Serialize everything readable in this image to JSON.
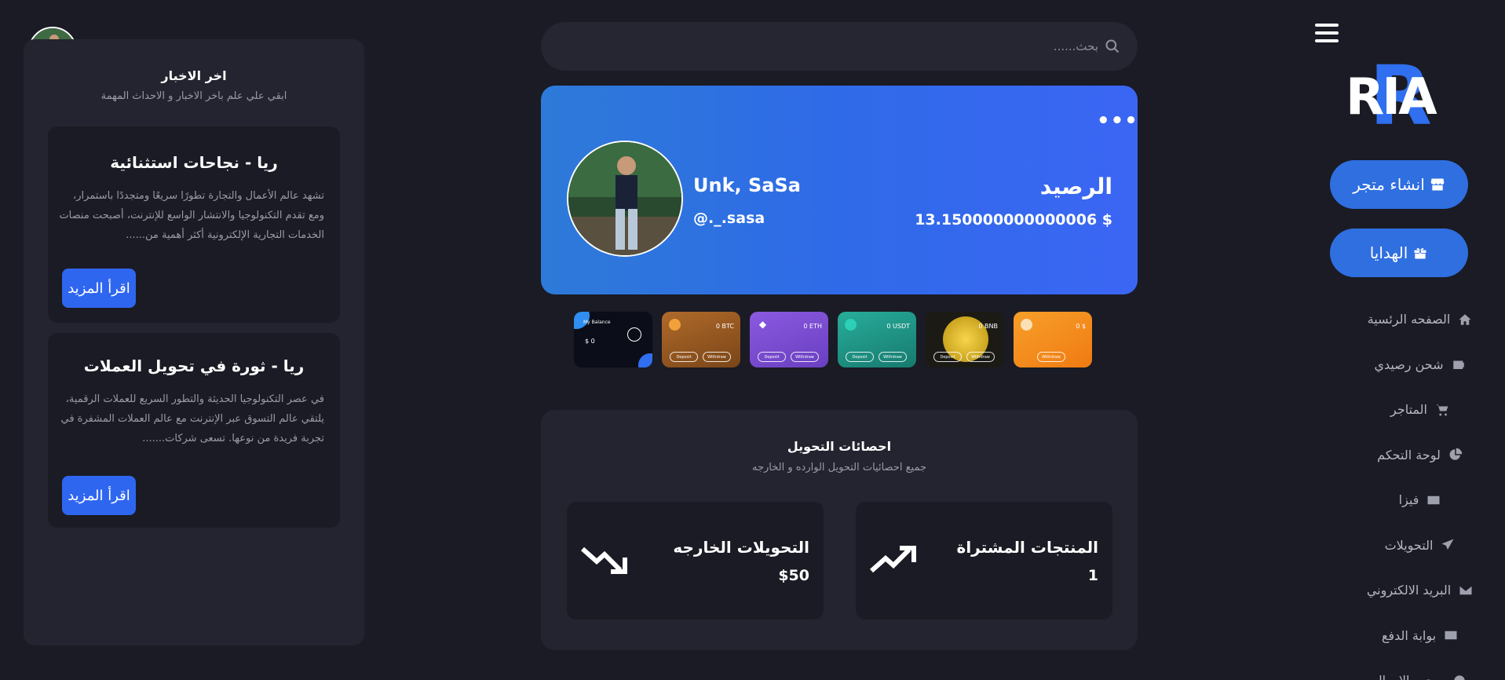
{
  "sidebar": {
    "logo_text": "RIA",
    "create_store_label": "انشاء متجر",
    "gifts_label": "الهدايا",
    "items": [
      {
        "label": "الصفحه الرئسية",
        "icon": "home-icon"
      },
      {
        "label": "شحن رصيدي",
        "icon": "wallet-icon"
      },
      {
        "label": "المتاجر",
        "icon": "cart-icon"
      },
      {
        "label": "لوحة التحكم",
        "icon": "pie-chart-icon"
      },
      {
        "label": "فيزا",
        "icon": "credit-card-icon"
      },
      {
        "label": "التحويلات",
        "icon": "send-icon"
      },
      {
        "label": "البريد الالكتروني",
        "icon": "envelope-icon"
      },
      {
        "label": "بوابة الدفع",
        "icon": "payment-card-icon"
      },
      {
        "label": "سحب الاموال",
        "icon": "money-icon"
      }
    ]
  },
  "search": {
    "placeholder": "بحث......"
  },
  "balance": {
    "label": "الرصيد",
    "value": "13.150000000000006 $",
    "user_name": "Unk, SaSa",
    "user_handle": "@._.sasa",
    "more": "•••"
  },
  "wallets": [
    {
      "name": "0 $",
      "color": "#f5871e",
      "buttons": [
        "Withdraw"
      ]
    },
    {
      "name": "0 BNB",
      "color": "#1b1a14",
      "buttons": [
        "Deposit",
        "Withdraw"
      ]
    },
    {
      "name": "0 USDT",
      "color": "#1f9a8a",
      "buttons": [
        "Deposit",
        "Withdraw"
      ]
    },
    {
      "name": "0 ETH",
      "color": "#7a4fd0",
      "buttons": [
        "Deposit",
        "Withdraw"
      ]
    },
    {
      "name": "0 BTC",
      "color": "#9b5b22",
      "buttons": [
        "Deposit",
        "Withdraw"
      ]
    },
    {
      "name": "My Balance",
      "value": "$ 0",
      "color": "#0b0d18"
    }
  ],
  "stats": {
    "title": "احصائات التحويل",
    "subtitle": "جميع احصائيات التحويل الوارده و الخارجه",
    "purchased_label": "المنتجات المشتراة",
    "purchased_value": "1",
    "outgoing_label": "التحويلات الخارجه",
    "outgoing_value": "$50"
  },
  "news": {
    "title": "اخر الاخبار",
    "subtitle": "ابقي علي علم باخر الاخبار و الاحداث المهمة",
    "articles": [
      {
        "title": "ريا - نجاحات استثنائية",
        "body": "تشهد عالم الأعمال والتجارة تطورًا سريعًا ومتجددًا باستمرار، ومع تقدم التكنولوجيا والانتشار الواسع للإنترنت، أصبحت منصات الخدمات التجارية الإلكترونية أكثر أهمية من......",
        "button": "اقرأ المزيد"
      },
      {
        "title": "ريا - ثورة في تحويل العملات",
        "body": "في عصر التكنولوجيا الحديثة والتطور السريع للعملات الرقمية، يلتقي عالم التسوق عبر الإنترنت مع عالم العملات المشفرة في تجربة فريدة من نوعها. تسعى شركات.......",
        "button": "اقرأ المزيد"
      }
    ]
  }
}
